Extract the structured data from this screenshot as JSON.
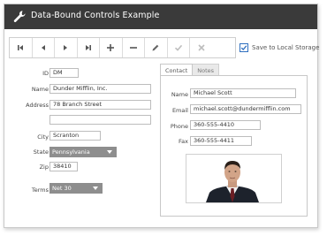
{
  "window": {
    "title": "Data-Bound Controls Example",
    "title_icon": "wrench-icon"
  },
  "toolbar": {
    "buttons": [
      {
        "name": "first-record",
        "icon": "first-icon"
      },
      {
        "name": "previous-record",
        "icon": "previous-icon"
      },
      {
        "name": "next-record",
        "icon": "next-icon"
      },
      {
        "name": "last-record",
        "icon": "last-icon"
      },
      {
        "name": "add-record",
        "icon": "plus-icon"
      },
      {
        "name": "delete-record",
        "icon": "minus-icon"
      },
      {
        "name": "edit-record",
        "icon": "pencil-icon"
      },
      {
        "name": "save-record",
        "icon": "checkmark-icon"
      },
      {
        "name": "cancel-edit",
        "icon": "close-icon"
      }
    ]
  },
  "storage": {
    "label": "Save to Local Storage",
    "checked": true
  },
  "form": {
    "id": {
      "label": "ID",
      "value": "DM"
    },
    "name": {
      "label": "Name",
      "value": "Dunder Mifflin, Inc."
    },
    "address": {
      "label": "Address",
      "value": "78 Branch Street",
      "value2": ""
    },
    "city": {
      "label": "City",
      "value": "Scranton"
    },
    "state": {
      "label": "State",
      "value": "Pennsylvania"
    },
    "zip": {
      "label": "Zip",
      "value": "38410"
    },
    "terms": {
      "label": "Terms",
      "value": "Net 30"
    }
  },
  "tabs": [
    {
      "label": "Contact",
      "active": true
    },
    {
      "label": "Notes",
      "active": false
    }
  ],
  "contact": {
    "name": {
      "label": "Name",
      "value": "Michael Scott"
    },
    "email": {
      "label": "Email",
      "value": "michael.scott@dundermifflin.com"
    },
    "phone": {
      "label": "Phone",
      "value": "360-555-4410"
    },
    "fax": {
      "label": "Fax",
      "value": "360-555-4411"
    },
    "photo": "contact-photo"
  },
  "colors": {
    "titlebar": "#3a3a3a",
    "accent": "#2f6fbf",
    "select_bg": "#8e8e8e"
  }
}
